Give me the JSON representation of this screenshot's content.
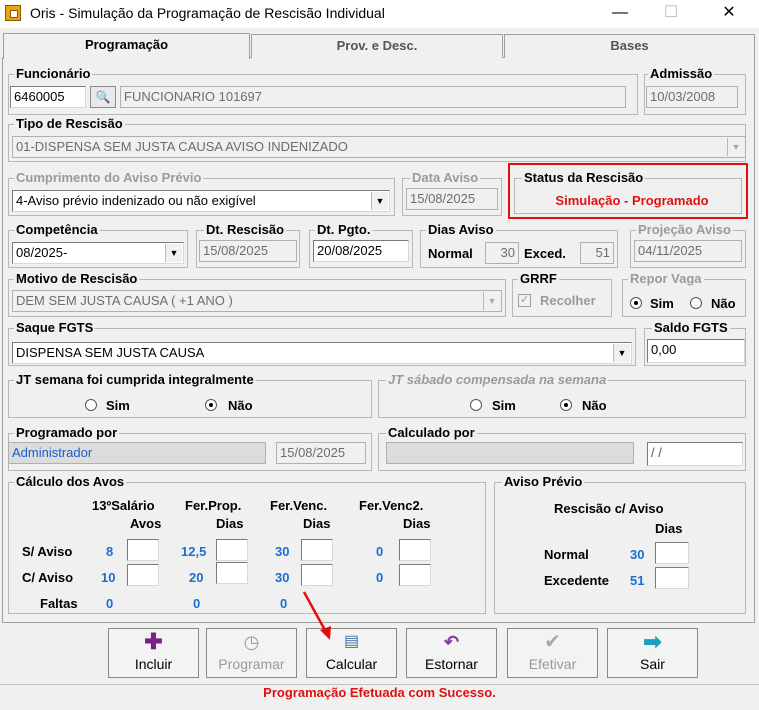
{
  "window": {
    "title": "Oris - Simulação da Programação de Rescisão Individual",
    "minimize": "—",
    "maximize": "☐",
    "close": "✕"
  },
  "tabs": [
    {
      "label": "Programação"
    },
    {
      "label": "Prov. e Desc."
    },
    {
      "label": "Bases"
    }
  ],
  "funcionario": {
    "label": "Funcionário",
    "code": "6460005",
    "name": "FUNCIONARIO 101697"
  },
  "admissao": {
    "label": "Admissão",
    "value": "10/03/2008"
  },
  "tipo_rescisao": {
    "label": "Tipo de Rescisão",
    "value": "01-DISPENSA SEM JUSTA CAUSA AVISO INDENIZADO"
  },
  "cumprimento": {
    "label": "Cumprimento do Aviso Prévio",
    "value": "4-Aviso prévio indenizado ou não exigível"
  },
  "data_aviso": {
    "label": "Data Aviso",
    "value": "15/08/2025"
  },
  "status_rescisao": {
    "label": "Status da Rescisão",
    "value": "Simulação - Programado",
    "color": "#e01010"
  },
  "competencia": {
    "label": "Competência",
    "value": "08/2025-"
  },
  "dt_rescisao": {
    "label": "Dt. Rescisão",
    "value": "15/08/2025"
  },
  "dt_pgto": {
    "label": "Dt. Pgto.",
    "value": "20/08/2025"
  },
  "dias_aviso": {
    "label": "Dias Aviso",
    "normal_label": "Normal",
    "normal_value": "30",
    "exced_label": "Exced.",
    "exced_value": "51"
  },
  "projecao_aviso": {
    "label": "Projeção Aviso",
    "value": "04/11/2025"
  },
  "motivo": {
    "label": "Motivo de Rescisão",
    "value": "DEM SEM JUSTA CAUSA ( +1 ANO )"
  },
  "grrf": {
    "label": "GRRF",
    "checkbox_label": "Recolher",
    "checked": true
  },
  "repor_vaga": {
    "label": "Repor Vaga",
    "sim": "Sim",
    "nao": "Não",
    "selected": "Sim"
  },
  "saque_fgts": {
    "label": "Saque FGTS",
    "value": "DISPENSA SEM JUSTA CAUSA"
  },
  "saldo_fgts": {
    "label": "Saldo FGTS",
    "value": "0,00"
  },
  "jt_semana": {
    "label": "JT semana foi cumprida integralmente",
    "sim": "Sim",
    "nao": "Não",
    "selected": "Não"
  },
  "jt_sabado": {
    "label": "JT sábado compensada na semana",
    "sim": "Sim",
    "nao": "Não",
    "selected": "Não"
  },
  "programado_por": {
    "label": "Programado por",
    "user": "Administrador",
    "date": "15/08/2025"
  },
  "calculado_por": {
    "label": "Calculado por",
    "user": "",
    "date": " / /"
  },
  "calculo_avos": {
    "label": "Cálculo dos Avos",
    "headers": [
      {
        "line1": "13ºSalário",
        "line2": "Avos"
      },
      {
        "line1": "Fer.Prop.",
        "line2": "Dias"
      },
      {
        "line1": "Fer.Venc.",
        "line2": "Dias"
      },
      {
        "line1": "Fer.Venc2.",
        "line2": "Dias"
      }
    ],
    "rows": [
      {
        "label": "S/ Aviso",
        "values": [
          "8",
          "12,5",
          "30",
          "0"
        ]
      },
      {
        "label": "C/ Aviso",
        "values": [
          "10",
          "20",
          "30",
          "0"
        ]
      },
      {
        "label": "Faltas",
        "values": [
          "0",
          "0",
          "0"
        ]
      }
    ]
  },
  "aviso_previo": {
    "label": "Aviso Prévio",
    "header1": "Rescisão c/ Aviso",
    "header2": "Dias",
    "rows": [
      {
        "label": "Normal",
        "value": "30"
      },
      {
        "label": "Excedente",
        "value": "51"
      }
    ]
  },
  "buttons": [
    {
      "label": "Incluir",
      "icon": "plus-icon",
      "enabled": true
    },
    {
      "label": "Programar",
      "icon": "clock-icon",
      "enabled": false
    },
    {
      "label": "Calcular",
      "icon": "calculator-icon",
      "enabled": true
    },
    {
      "label": "Estornar",
      "icon": "undo-arrow-icon",
      "enabled": true
    },
    {
      "label": "Efetivar",
      "icon": "check-icon",
      "enabled": false
    },
    {
      "label": "Sair",
      "icon": "exit-arrow-icon",
      "enabled": true
    }
  ],
  "status_message": "Programação Efetuada com Sucesso."
}
